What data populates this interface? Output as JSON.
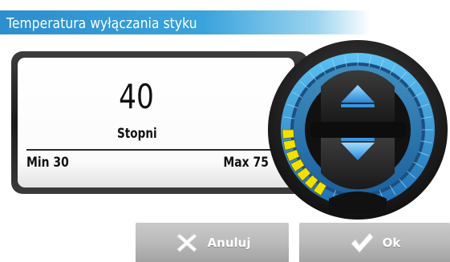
{
  "header": {
    "title": "Temperatura wyłączania styku"
  },
  "setting": {
    "value": "40",
    "unit": "Stopni",
    "min_label": "Min 30",
    "max_label": "Max 75",
    "min": 30,
    "max": 75,
    "current": 40
  },
  "dial": {
    "up_icon": "triangle-up-icon",
    "down_icon": "triangle-down-icon",
    "level_color": "#f2e000",
    "accent_color": "#3aa3dc"
  },
  "buttons": {
    "cancel_label": "Anuluj",
    "cancel_icon": "x-icon",
    "ok_label": "Ok",
    "ok_icon": "checkmark-icon"
  }
}
